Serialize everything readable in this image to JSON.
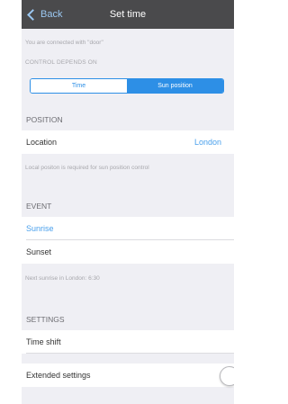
{
  "nav": {
    "back_label": "Back",
    "title": "Set time"
  },
  "info": {
    "connected": "You are connected with \"door\"",
    "control_depends": "CONTROL DEPENDS ON"
  },
  "segment": {
    "time": "Time",
    "sun_position": "Sun position",
    "selected": "Sun position"
  },
  "position": {
    "header": "POSITION",
    "location_label": "Location",
    "location_value": "London",
    "note": "Local positon is required for sun position control"
  },
  "event": {
    "header": "EVENT",
    "sunrise": "Sunrise",
    "sunset": "Sunset",
    "selected": "Sunrise",
    "note": "Next sunrise in London: 6:30"
  },
  "settings": {
    "header": "SETTINGS",
    "time_shift": "Time shift",
    "extended": "Extended settings",
    "extended_on": false
  },
  "colors": {
    "accent": "#2d8fe6",
    "navbar": "#4a4a4c",
    "background": "#efeff4"
  }
}
